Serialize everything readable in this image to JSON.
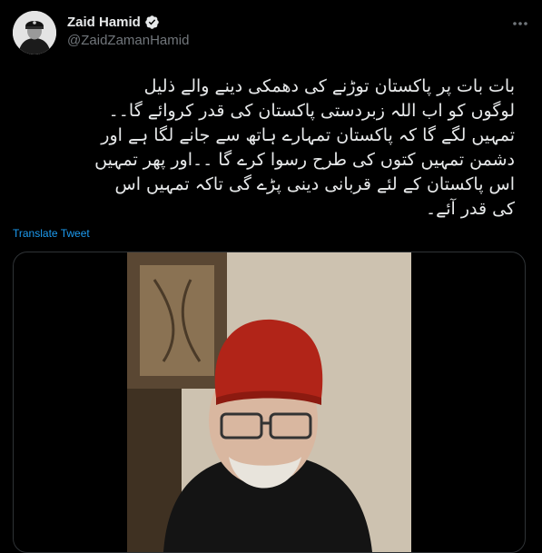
{
  "tweet": {
    "author": {
      "display_name": "Zaid Hamid",
      "handle": "@ZaidZamanHamid",
      "verified": true
    },
    "text": "بات بات پر پاکستان توڑنے کی دھمکی دینے والے ذلیل\nلوگوں کو اب اللہ زبردستی پاکستان کی قدر کروائے گا۔۔\nتمہیں لگے گا کہ پاکستان تمہارے ہاتھ سے جانے لگا ہے اور\nدشمن تمہیں کتوں کی طرح رسوا کرے گا ۔۔اور پھر تمہیں\nاس پاکستان کے لئے قربانی دینی پڑے گی تاکہ تمہیں اس\nکی قدر آئے۔",
    "translate_label": "Translate Tweet",
    "media": {
      "type": "video"
    }
  },
  "icons": {
    "more": "more-horizontal-icon",
    "verified": "verified-badge-icon"
  },
  "colors": {
    "background": "#000000",
    "text": "#e7e9ea",
    "secondary_text": "#71767b",
    "accent": "#1d9bf0",
    "border": "#2f3336"
  }
}
